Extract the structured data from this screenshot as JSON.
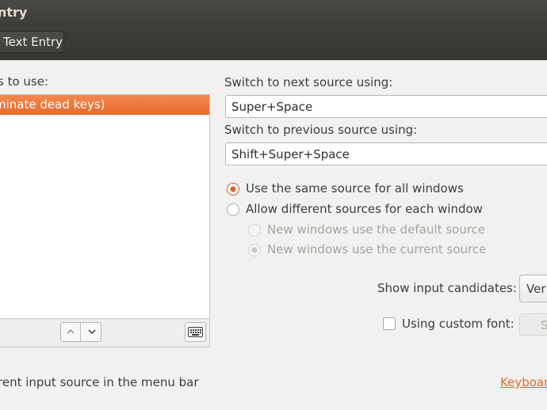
{
  "window": {
    "title": "ntry"
  },
  "toolbar": {
    "breadcrumb": "Text Entry"
  },
  "sources": {
    "label": "s to use:",
    "items": [
      {
        "label": "minate dead keys)"
      }
    ]
  },
  "shortcuts": {
    "next_label": "Switch to next source using:",
    "next_value": "Super+Space",
    "prev_label": "Switch to previous source using:",
    "prev_value": "Shift+Super+Space"
  },
  "options": {
    "same_source": "Use the same source for all windows",
    "different_sources": "Allow different sources for each window",
    "default_source": "New windows use the default source",
    "current_source": "New windows use the current source",
    "candidates_label": "Show input candidates:",
    "candidates_value": "Ver",
    "custom_font_label": "Using custom font:",
    "custom_font_value": "S"
  },
  "footer": {
    "menu_bar_text": "rent input source in the menu bar",
    "keyboard_link": "Keyboar"
  },
  "colors": {
    "accent": "#e86b2c",
    "titlebar": "#3e3d39",
    "background": "#f2f1f0"
  }
}
